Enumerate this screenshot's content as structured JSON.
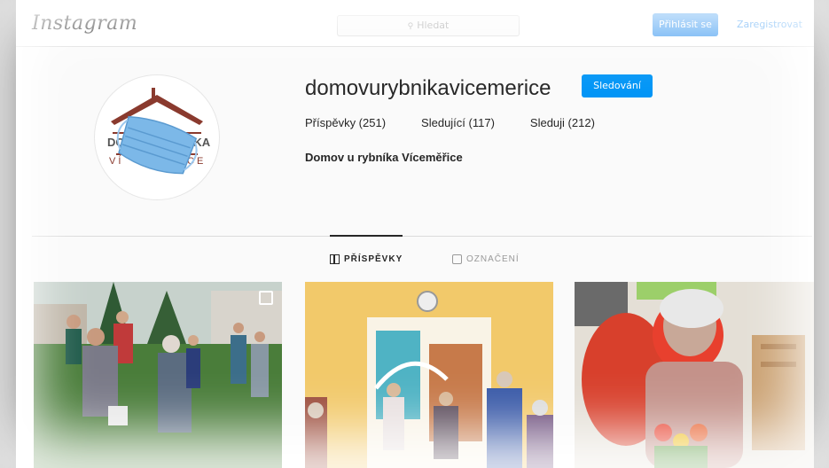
{
  "header": {
    "logo_text": "Instagram",
    "search_placeholder": "Hledat",
    "login_label": "Přihlásit se",
    "signup_label": "Zaregistrovat"
  },
  "profile": {
    "username": "domovurybnikavicemerice",
    "follow_label": "Sledování",
    "stats": {
      "posts": "Příspěvky (251)",
      "followers": "Sledující (117)",
      "following": "Sleduji (212)"
    },
    "full_name": "Domov u rybníka Víceměřice",
    "avatar_text_top": "DO",
    "avatar_text_right": "NKA",
    "avatar_text_mid": "V Í",
    "avatar_text_mid_right": "C E"
  },
  "tabs": {
    "posts_label": "PŘÍSPĚVKY",
    "tagged_label": "OZNAČENÍ"
  },
  "colors": {
    "primary_button": "#3897f0",
    "follow_button": "#0095f6",
    "mask_blue": "#7cb8e8"
  },
  "icons": [
    "search-icon",
    "grid-icon",
    "tag-icon",
    "multiple-posts-icon"
  ]
}
